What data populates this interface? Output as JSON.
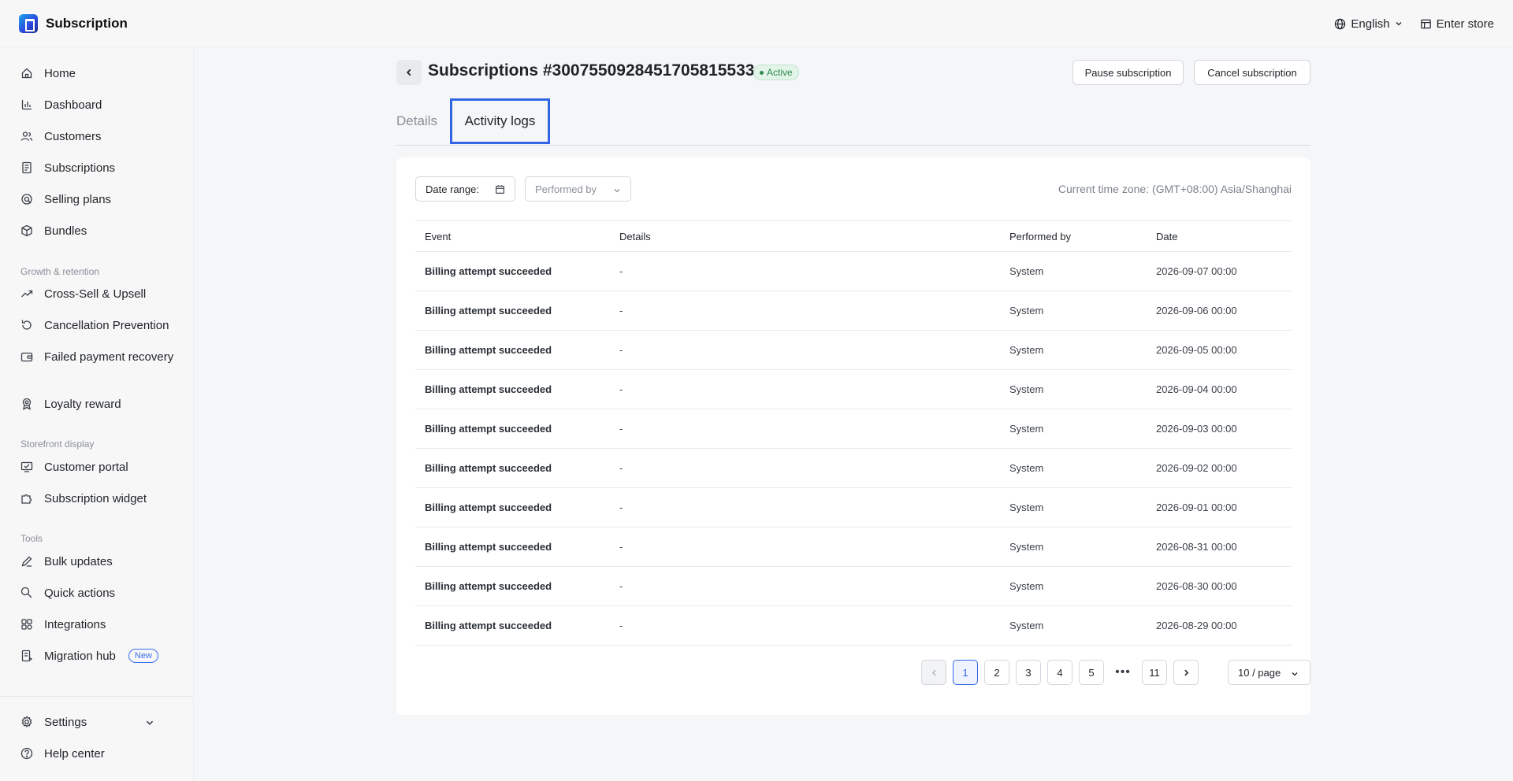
{
  "app": {
    "title": "Subscription"
  },
  "topbar": {
    "language": "English",
    "enter_store": "Enter store"
  },
  "sidebar": {
    "main_items": [
      {
        "label": "Home",
        "icon": "home-icon"
      },
      {
        "label": "Dashboard",
        "icon": "bar-chart-icon"
      },
      {
        "label": "Customers",
        "icon": "users-icon"
      },
      {
        "label": "Subscriptions",
        "icon": "document-icon"
      },
      {
        "label": "Selling plans",
        "icon": "plans-icon"
      },
      {
        "label": "Bundles",
        "icon": "box-icon"
      }
    ],
    "growth_title": "Growth & retention",
    "growth_items": [
      {
        "label": "Cross-Sell & Upsell",
        "icon": "trend-up-icon"
      },
      {
        "label": "Cancellation Prevention",
        "icon": "refresh-icon"
      },
      {
        "label": "Failed payment recovery",
        "icon": "wallet-icon"
      },
      {
        "label": "Loyalty reward",
        "icon": "award-icon"
      }
    ],
    "storefront_title": "Storefront display",
    "storefront_items": [
      {
        "label": "Customer portal",
        "icon": "monitor-icon"
      },
      {
        "label": "Subscription widget",
        "icon": "puzzle-icon"
      }
    ],
    "tools_title": "Tools",
    "tools_items": [
      {
        "label": "Bulk updates",
        "icon": "edit-icon"
      },
      {
        "label": "Quick actions",
        "icon": "bolt-icon"
      },
      {
        "label": "Integrations",
        "icon": "grid-icon"
      },
      {
        "label": "Migration hub",
        "icon": "migrate-icon",
        "badge": "New"
      }
    ],
    "settings": "Settings",
    "help": "Help center"
  },
  "header": {
    "title": "Subscriptions #3007550928451705815533",
    "status": "Active",
    "pause_label": "Pause subscription",
    "cancel_label": "Cancel subscription"
  },
  "tabs": [
    {
      "label": "Details",
      "active": false
    },
    {
      "label": "Activity logs",
      "active": true
    }
  ],
  "filters": {
    "date_range": "Date range:",
    "performed_by_placeholder": "Performed by",
    "timezone": "Current time zone: (GMT+08:00) Asia/Shanghai"
  },
  "table": {
    "columns": [
      "Event",
      "Details",
      "Performed by",
      "Date"
    ],
    "rows": [
      [
        "Billing attempt succeeded",
        "-",
        "System",
        "2026-09-07 00:00"
      ],
      [
        "Billing attempt succeeded",
        "-",
        "System",
        "2026-09-06 00:00"
      ],
      [
        "Billing attempt succeeded",
        "-",
        "System",
        "2026-09-05 00:00"
      ],
      [
        "Billing attempt succeeded",
        "-",
        "System",
        "2026-09-04 00:00"
      ],
      [
        "Billing attempt succeeded",
        "-",
        "System",
        "2026-09-03 00:00"
      ],
      [
        "Billing attempt succeeded",
        "-",
        "System",
        "2026-09-02 00:00"
      ],
      [
        "Billing attempt succeeded",
        "-",
        "System",
        "2026-09-01 00:00"
      ],
      [
        "Billing attempt succeeded",
        "-",
        "System",
        "2026-08-31 00:00"
      ],
      [
        "Billing attempt succeeded",
        "-",
        "System",
        "2026-08-30 00:00"
      ],
      [
        "Billing attempt succeeded",
        "-",
        "System",
        "2026-08-29 00:00"
      ]
    ]
  },
  "pagination": {
    "pages": [
      "1",
      "2",
      "3",
      "4",
      "5"
    ],
    "last_page": "11",
    "current": "1",
    "page_size": "10 / page"
  }
}
